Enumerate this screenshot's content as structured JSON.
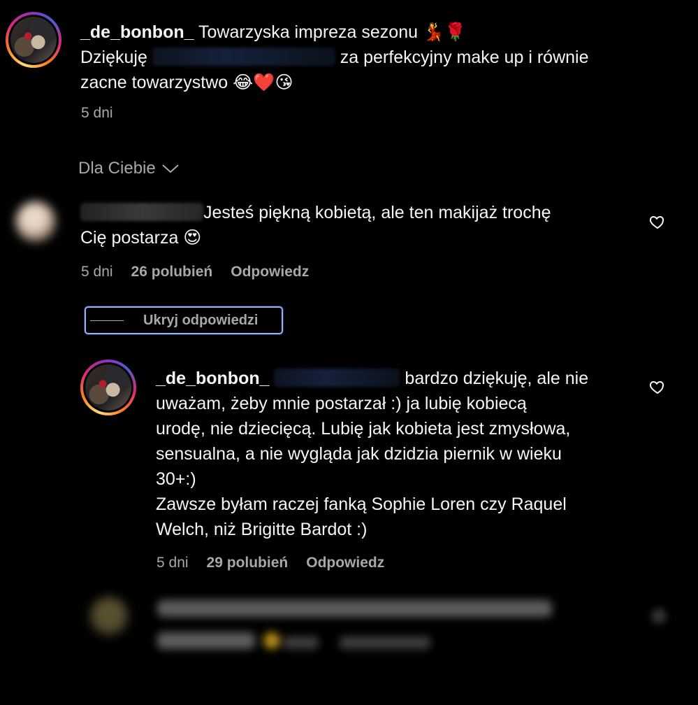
{
  "post": {
    "username": "_de_bonbon_",
    "line1_text": " Towarzyska impreza sezonu 💃🌹",
    "line2_before": "Dziękuję ",
    "line2_after": " za perfekcyjny make up i równie",
    "line3": "zacne towarzystwo 😂❤️😘",
    "time": "5 dni"
  },
  "filter": {
    "label": "Dla Ciebie"
  },
  "comment": {
    "line1": "Jesteś piękną kobietą, ale ten makijaż trochę",
    "line2": "Cię postarza 😍",
    "time": "5 dni",
    "likes": "26 polubień",
    "reply": "Odpowiedz"
  },
  "hide_replies": {
    "label": "Ukryj odpowiedzi"
  },
  "reply": {
    "username": "_de_bonbon_",
    "line1_after": "bardzo dziękuję, ale nie",
    "line2": "uważam, żeby mnie postarzał :) ja lubię kobiecą",
    "line3": "urodę, nie dziecięcą. Lubię jak kobieta jest zmysłowa,",
    "line4": "sensualna, a nie wygląda jak dzidzia piernik w wieku",
    "line5": "30+:)",
    "line6": "Zawsze byłam raczej fanką Sophie Loren czy Raquel",
    "line7": "Welch, niż Brigitte Bardot :)",
    "time": "5 dni",
    "likes": "29 polubień",
    "reply": "Odpowiedz"
  },
  "icons": {
    "heart": "heart-icon",
    "chevron": "chevron-down-icon"
  },
  "colors": {
    "background": "#000000",
    "text": "#f5f5f5",
    "secondary": "#a8a8a8",
    "focus": "#8fb4ff"
  }
}
